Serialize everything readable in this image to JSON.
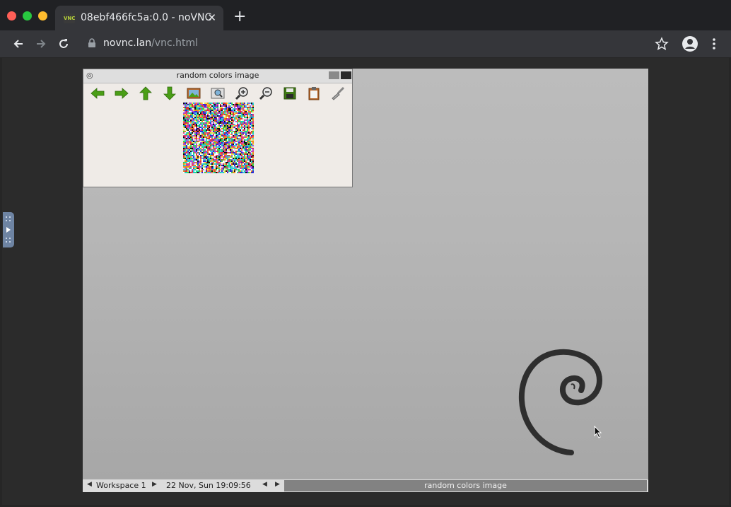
{
  "browser": {
    "tab_title": "08ebf466fc5a:0.0 - noVNC",
    "favicon_text": "VNC",
    "url_host": "novnc.lan",
    "url_path": "/vnc.html"
  },
  "app_window": {
    "title": "random colors image",
    "toolbar_icons": [
      "back-arrow-icon",
      "forward-arrow-icon",
      "up-arrow-icon",
      "down-arrow-icon",
      "image-icon",
      "zoom-fit-icon",
      "zoom-in-icon",
      "zoom-out-icon",
      "save-icon",
      "clipboard-icon",
      "brush-icon"
    ]
  },
  "taskbar": {
    "workspace": "Workspace 1",
    "clock": "22 Nov, Sun 19:09:56",
    "active_task": "random colors image"
  },
  "colors": {
    "green_icon": "#4a9e16",
    "chrome_dark": "#202124",
    "desktop_gray": "#b4b4b4"
  }
}
